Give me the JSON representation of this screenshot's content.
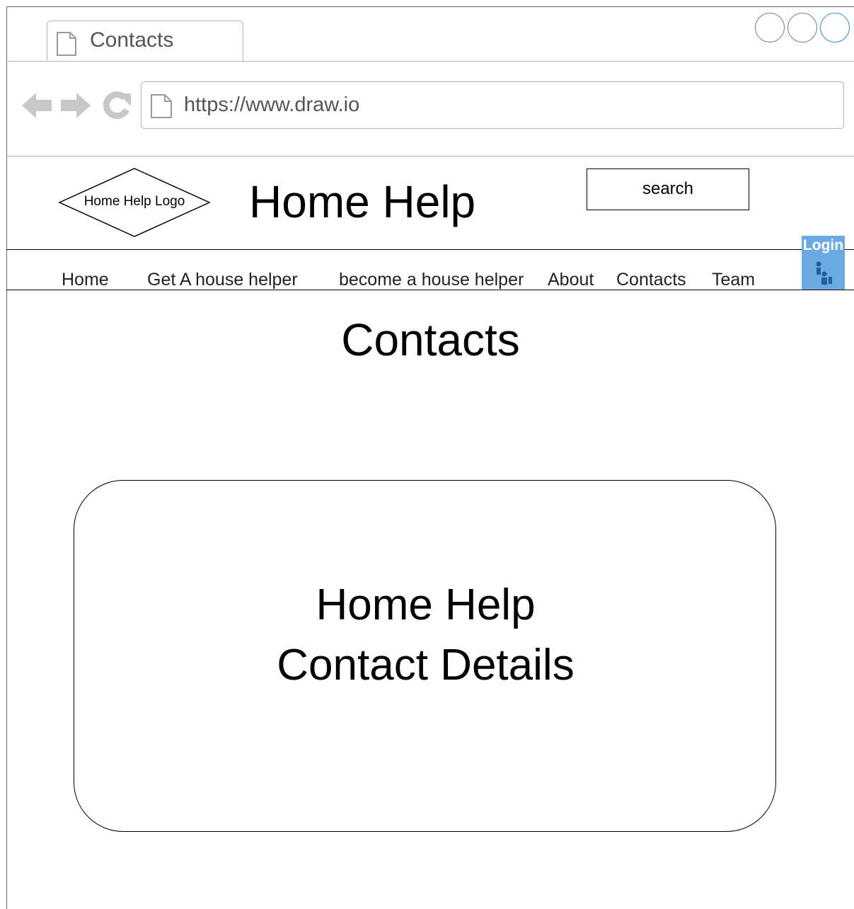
{
  "browser": {
    "tab_title": "Contacts",
    "url": "https://www.draw.io",
    "icons": [
      "back-arrow-icon",
      "forward-arrow-icon",
      "reload-icon",
      "page-icon"
    ],
    "window_buttons": [
      "window-button",
      "window-button",
      "window-button"
    ],
    "accent_color": "#2a8fd6"
  },
  "header": {
    "logo_text": "Home Help Logo",
    "site_title": "Home Help",
    "search_label": "search",
    "login_label": "Login",
    "login_color": "#6aa9e4"
  },
  "nav": {
    "items": [
      "Home",
      "Get A house helper",
      "become a house helper",
      "About",
      "Contacts",
      "Team"
    ]
  },
  "main": {
    "heading": "Contacts",
    "card_line1": "Home Help",
    "card_line2": "Contact Details"
  }
}
